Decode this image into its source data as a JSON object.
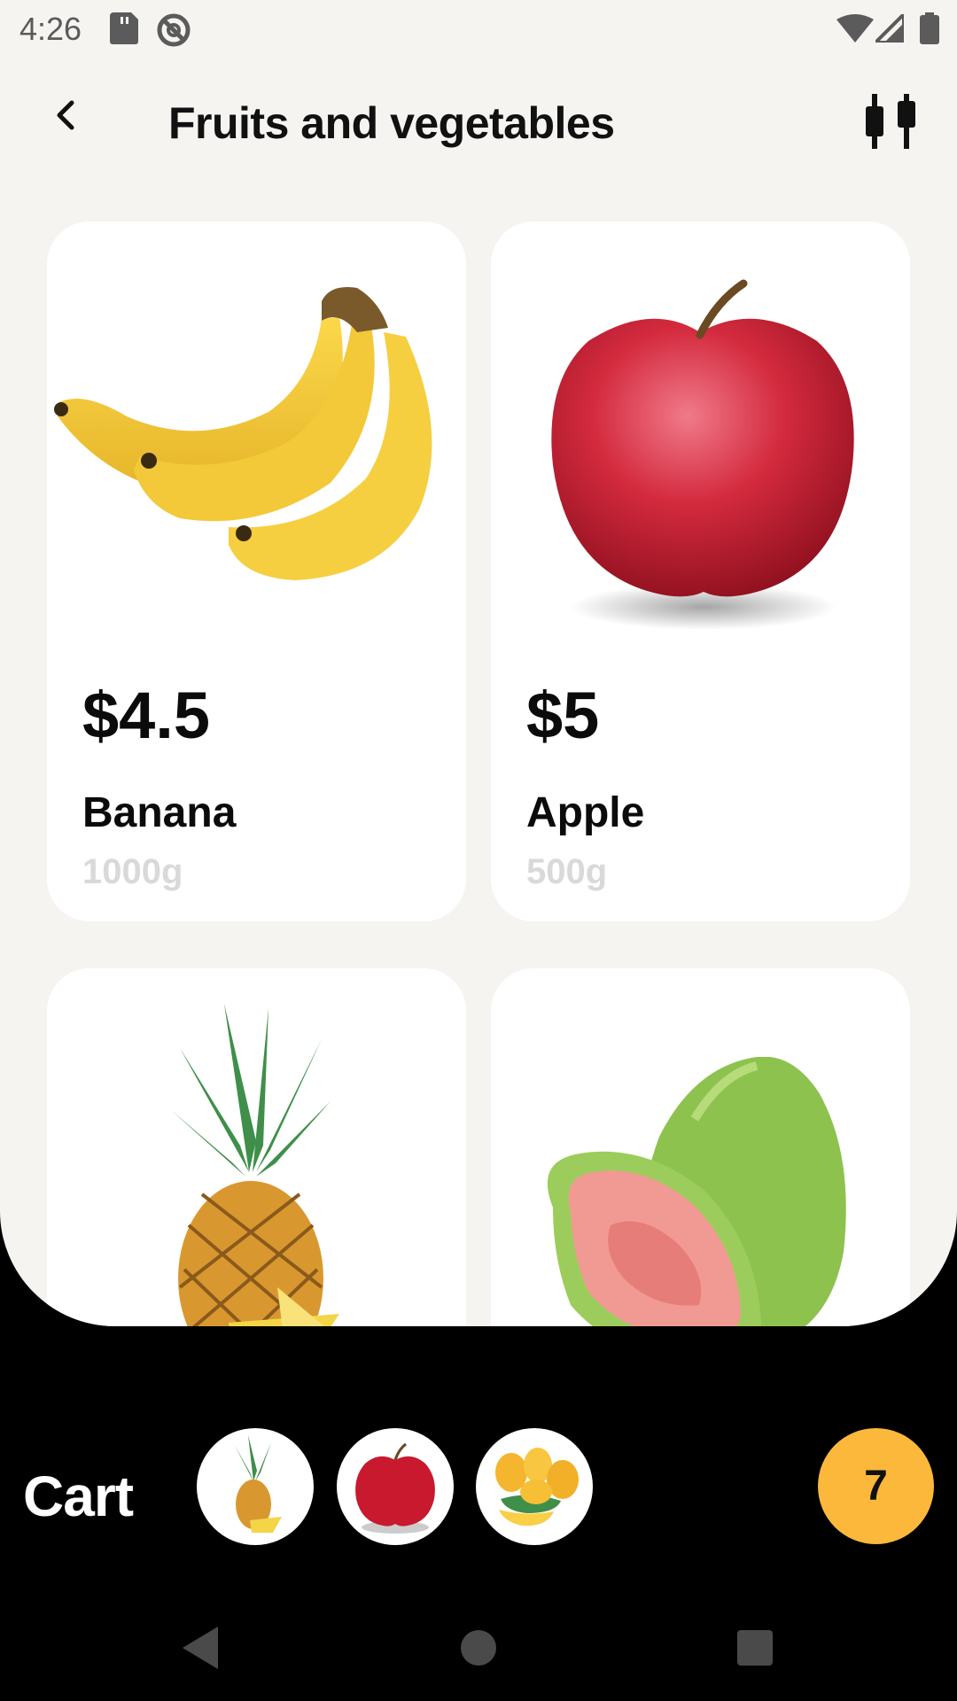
{
  "status_bar": {
    "time": "4:26",
    "icons": [
      "sd-card-icon",
      "at-sign-icon",
      "wifi-icon",
      "signal-icon",
      "battery-icon"
    ],
    "text_color": "#5b5b5b"
  },
  "header": {
    "title": "Fruits and vegetables",
    "back_icon": "chevron-left-icon",
    "filter_icon": "filter-sliders-icon"
  },
  "products": [
    {
      "price": "$4.5",
      "name": "Banana",
      "weight": "1000g",
      "image": "banana-image"
    },
    {
      "price": "$5",
      "name": "Apple",
      "weight": "500g",
      "image": "apple-image"
    },
    {
      "price": "",
      "name": "",
      "weight": "",
      "image": "pineapple-image"
    },
    {
      "price": "",
      "name": "",
      "weight": "",
      "image": "guava-image"
    }
  ],
  "cart": {
    "label": "Cart",
    "items": [
      "pineapple-thumb",
      "apple-thumb",
      "mango-thumb"
    ],
    "count": "7",
    "count_color": "#fbb83b"
  },
  "nav": {
    "buttons": [
      "back-triangle-icon",
      "home-circle-icon",
      "recents-square-icon"
    ]
  },
  "colors": {
    "sheet_background": "#f5f4f1",
    "card_background": "#ffffff",
    "weight_text": "#d9d9d9",
    "footer_background": "#000000"
  }
}
